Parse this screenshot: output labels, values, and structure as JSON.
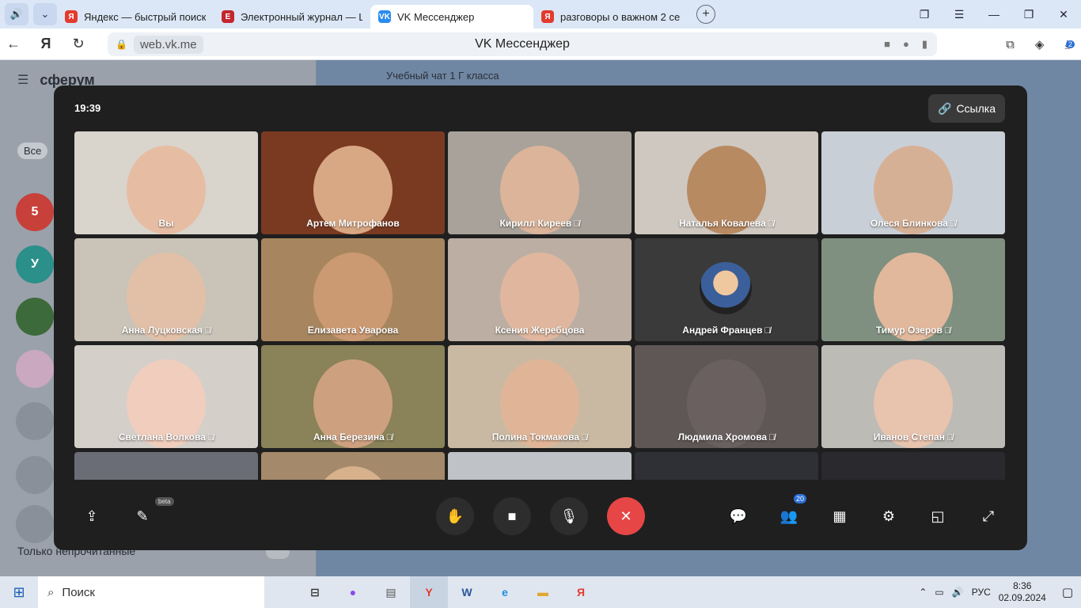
{
  "browser": {
    "tabs": [
      {
        "title": "Яндекс — быстрый поиск",
        "icon": "yandex-icon",
        "color": "#e23b2e",
        "letter": "Я"
      },
      {
        "title": "Электронный журнал — Ш",
        "icon": "journal-icon",
        "color": "#c4262e",
        "letter": "Е"
      },
      {
        "title": "VK Мессенджер",
        "icon": "vk-messenger-icon",
        "color": "#2a8cf0",
        "letter": "VK"
      },
      {
        "title": "разговоры о важном 2 се",
        "icon": "yandex-icon",
        "color": "#e23b2e",
        "letter": "Я"
      }
    ],
    "url": "web.vk.me",
    "page_title": "VK Мессенджер",
    "download_count": "2"
  },
  "vk": {
    "logo": "сферум",
    "filter": "Все",
    "avatar_labels": [
      "5",
      "У"
    ],
    "chat_title": "Учебный чат 1 Г класса",
    "only_unread": "Только непрочитанные"
  },
  "call": {
    "clock": "19:39",
    "link_label": "Ссылка",
    "participants": [
      {
        "name": "Вы",
        "muted": false,
        "bg": "#d9d4cc",
        "skin": "#e6bda2"
      },
      {
        "name": "Артем Митрофанов",
        "muted": false,
        "bg": "#7a3a22",
        "skin": "#d8a783"
      },
      {
        "name": "Кирилл Киреев",
        "muted": true,
        "bg": "#a8a29a",
        "skin": "#dcb49a"
      },
      {
        "name": "Наталья Ковалева",
        "muted": true,
        "bg": "#cfc8c0",
        "skin": "#b88a62"
      },
      {
        "name": "Олеся Блинкова",
        "muted": true,
        "bg": "#c9cfd6",
        "skin": "#d6b095"
      },
      {
        "name": "Анна Луцковская",
        "muted": true,
        "bg": "#c9c3b8",
        "skin": "#e2c0a8"
      },
      {
        "name": "Елизавета Уварова",
        "muted": false,
        "bg": "#a7865f",
        "skin": "#cc9a72"
      },
      {
        "name": "Ксения Жеребцова",
        "muted": false,
        "bg": "#bcaea3",
        "skin": "#e0b79e"
      },
      {
        "name": "Андрей Францев",
        "muted": true,
        "bg": "#3a3a3a",
        "skin": "#f0c8a0",
        "avatar": true
      },
      {
        "name": "Тимур Озеров",
        "muted": true,
        "bg": "#7f9080",
        "skin": "#e1b89c"
      },
      {
        "name": "Светлана Волкова",
        "muted": true,
        "bg": "#d5cfc9",
        "skin": "#f0cdbd"
      },
      {
        "name": "Анна Березина",
        "muted": true,
        "bg": "#8a8258",
        "skin": "#cda080"
      },
      {
        "name": "Полина Токмакова",
        "muted": true,
        "bg": "#c9b9a3",
        "skin": "#e0b597"
      },
      {
        "name": "Людмила Хромова",
        "muted": true,
        "bg": "#5f5656",
        "skin": "#6b6060"
      },
      {
        "name": "Иванов Степан",
        "muted": true,
        "bg": "#bdbbb6",
        "skin": "#e8c3ae"
      },
      {
        "name": "",
        "muted": false,
        "bg": "#6a6d75",
        "skin": "#6a6d75"
      },
      {
        "name": "",
        "muted": false,
        "bg": "#a48a6a",
        "skin": "#d7b08c"
      },
      {
        "name": "",
        "muted": false,
        "bg": "#bfc3c8",
        "skin": "#bfc3c8"
      },
      {
        "name": "",
        "muted": false,
        "bg": "#2f3035",
        "skin": "#2f3035"
      },
      {
        "name": "",
        "muted": false,
        "bg": "#2a2a2e",
        "skin": "#2a2a2e"
      }
    ],
    "beta_label": "beta",
    "participants_count": "20"
  },
  "taskbar": {
    "search_label": "Поиск",
    "lang": "РУС",
    "time": "8:36",
    "date": "02.09.2024"
  }
}
